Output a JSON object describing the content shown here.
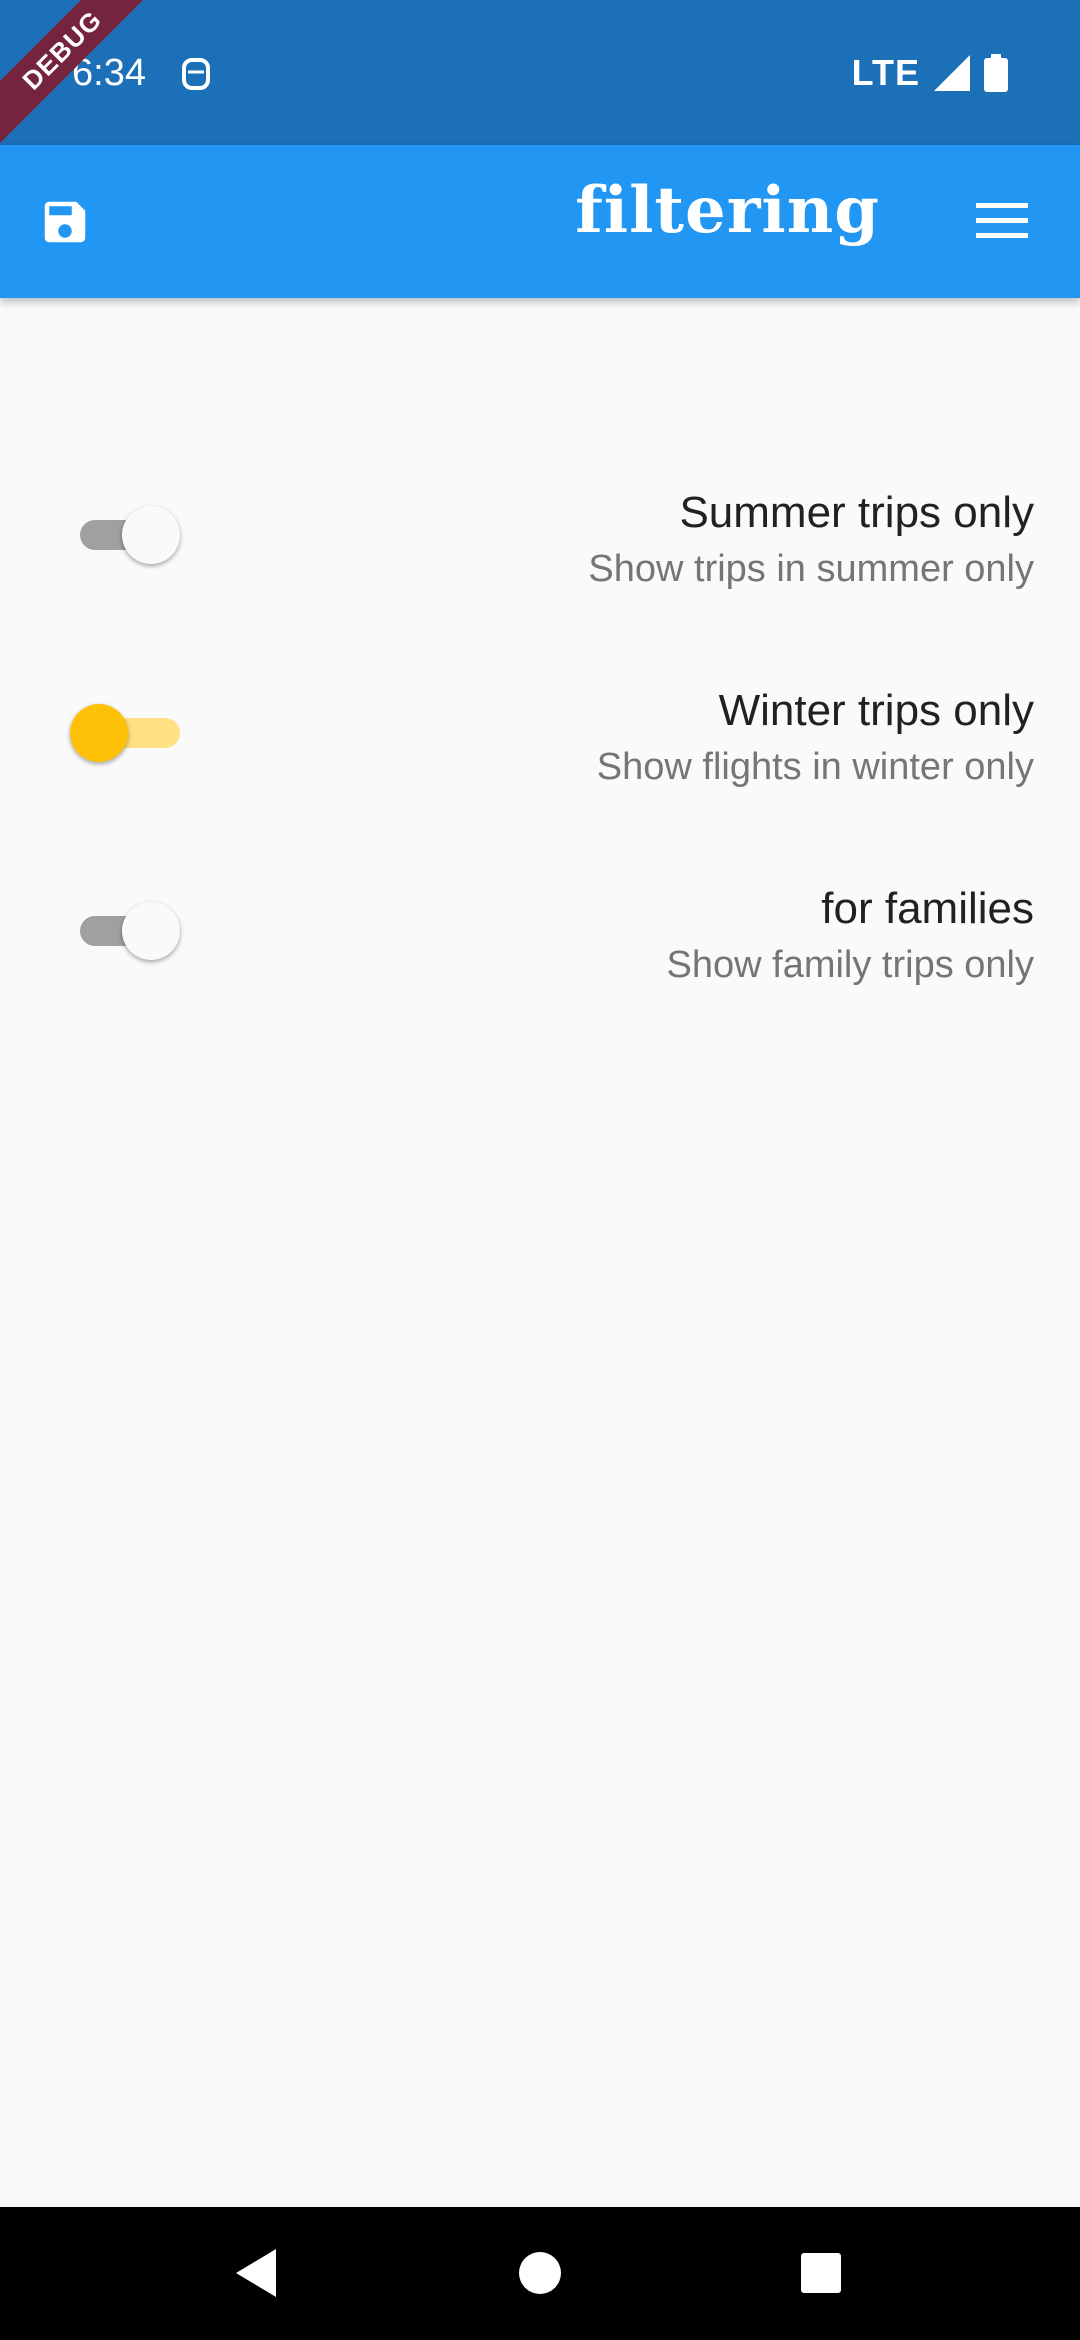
{
  "status_bar": {
    "time": "6:34",
    "network": "LTE"
  },
  "debug_banner": "DEBUG",
  "app_bar": {
    "title": "filtering",
    "leading_icon": "save-icon",
    "trailing_icon": "menu-icon",
    "color": "#2196f3"
  },
  "filters": [
    {
      "title": "Summer trips only",
      "subtitle": "Show trips in summer only",
      "enabled": false
    },
    {
      "title": "Winter trips only",
      "subtitle": "Show flights in winter only",
      "enabled": true
    },
    {
      "title": "for families",
      "subtitle": "Show family trips only",
      "enabled": false
    }
  ],
  "accent_color": "#ffc107",
  "nav_bar": {
    "icons": [
      "back-icon",
      "home-icon",
      "recents-icon"
    ]
  }
}
